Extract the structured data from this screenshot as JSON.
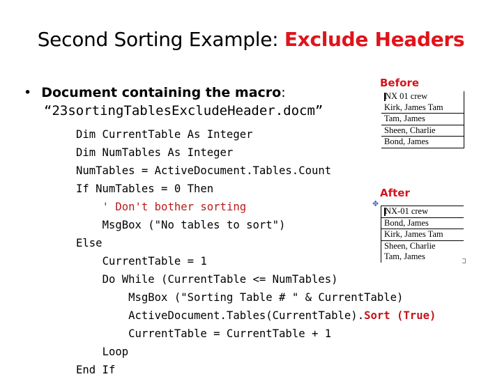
{
  "slide": {
    "title_plain": "Second Sorting Example: ",
    "title_accent": "Exclude Headers",
    "bullet_bold": "Document containing the macro",
    "bullet_colon": ":",
    "filename": "“23sortingTablesExcludeHeader.docm”",
    "code_lines": [
      {
        "indent": 0,
        "text": "Dim CurrentTable As Integer"
      },
      {
        "indent": 0,
        "text": "Dim NumTables As Integer"
      },
      {
        "indent": 0,
        "text": "NumTables = ActiveDocument.Tables.Count"
      },
      {
        "indent": 0,
        "text": "If NumTables = 0 Then"
      },
      {
        "indent": 1,
        "text": "' Don't bother sorting",
        "style": "comment"
      },
      {
        "indent": 1,
        "text": "MsgBox (\"No tables to sort\")"
      },
      {
        "indent": 0,
        "text": "Else"
      },
      {
        "indent": 1,
        "text": "CurrentTable = 1"
      },
      {
        "indent": 1,
        "text": "Do While (CurrentTable <= NumTables)"
      },
      {
        "indent": 2,
        "text": "MsgBox (\"Sorting Table # \" & CurrentTable)"
      },
      {
        "indent": 2,
        "text": "ActiveDocument.Tables(CurrentTable).",
        "highlight": "Sort (True)"
      },
      {
        "indent": 2,
        "text": "CurrentTable = CurrentTable + 1"
      },
      {
        "indent": 1,
        "text": "Loop"
      },
      {
        "indent": 0,
        "text": "End If"
      }
    ]
  },
  "before": {
    "label": "Before",
    "rows": [
      "NX 01 crew",
      "Kirk, James Tam",
      "Tam, James",
      "Sheen, Charlie",
      "Bond, James"
    ]
  },
  "after": {
    "label": "After",
    "rows": [
      "NX-01 crew",
      "Bond, James",
      "Kirk, James Tam",
      "Sheen, Charlie",
      "Tam, James"
    ]
  },
  "icons": {
    "move_handle": "✥"
  }
}
